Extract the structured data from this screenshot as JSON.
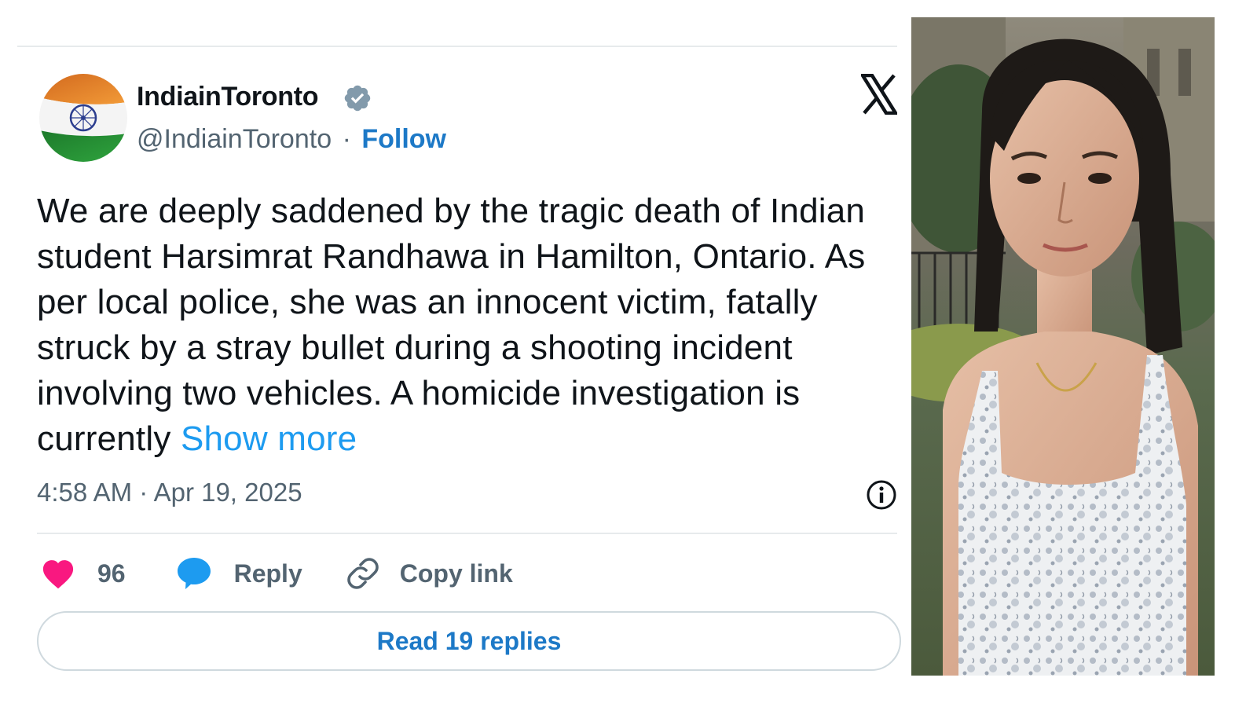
{
  "tweet": {
    "author_name": "IndiainToronto",
    "handle": "@IndiainToronto",
    "separator": "·",
    "follow_label": "Follow",
    "text": "We are deeply saddened by the tragic death of Indian student Harsimrat Randhawa in Hamilton, Ontario. As per local police, she was an innocent victim, fatally struck by a stray bullet during a shooting incident involving two vehicles. A homicide investigation is currently",
    "show_more_label": "Show more",
    "timestamp": "4:58 AM · Apr 19, 2025",
    "like_count": "96",
    "reply_label": "Reply",
    "copy_link_label": "Copy link",
    "read_replies_label": "Read 19 replies"
  },
  "icons": {
    "avatar": "india-flag-avatar",
    "verified": "verified-badge-icon",
    "platform": "x-logo-icon",
    "info": "info-icon",
    "like": "heart-icon",
    "reply": "speech-bubble-icon",
    "copy": "link-icon"
  },
  "colors": {
    "follow_link": "#1d79c7",
    "show_more_link": "#1d9bf0",
    "like_heart": "#f91880",
    "reply_bubble": "#1d9bf0",
    "secondary_text": "#536471",
    "primary_text": "#0f1419",
    "verified_badge": "#829aab"
  }
}
